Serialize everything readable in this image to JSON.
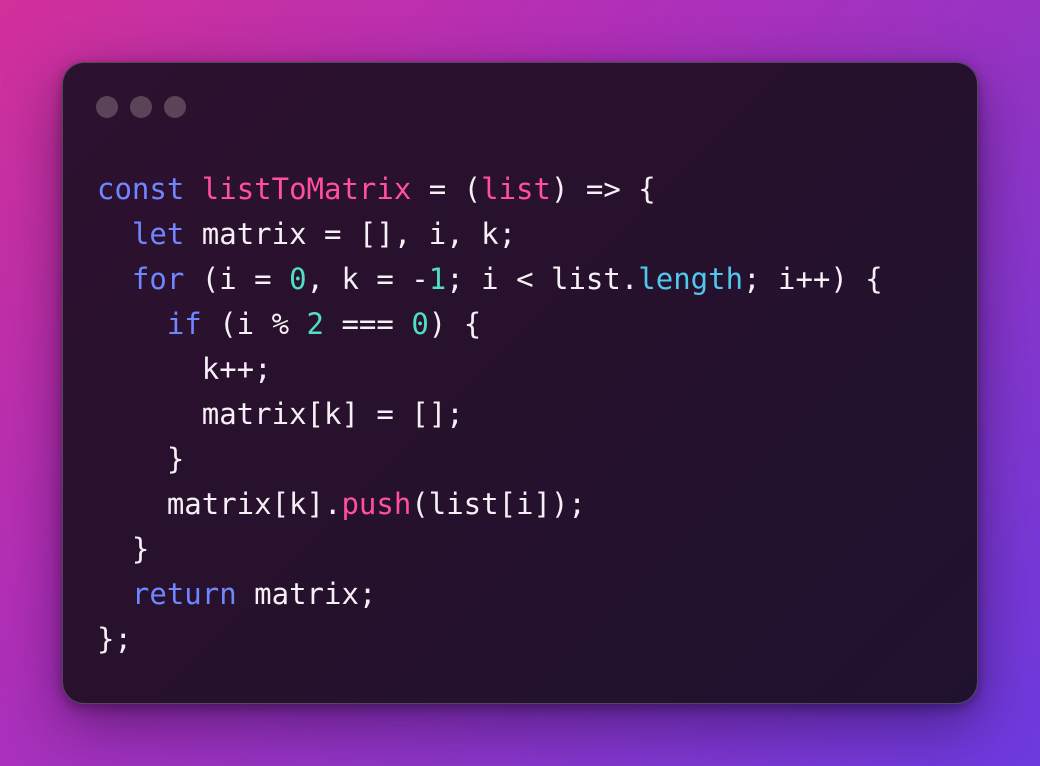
{
  "window": {
    "traffic_lights": [
      "dot",
      "dot",
      "dot"
    ]
  },
  "colors": {
    "keyword": "#6f86ff",
    "function": "#ff4f9e",
    "number": "#4fe0c2",
    "property": "#4fc7ee",
    "plain": "#f6f0f6"
  },
  "code": {
    "lines": [
      {
        "indent": 0,
        "tokens": [
          {
            "t": "const",
            "c": "kw"
          },
          {
            "t": " ",
            "c": "pl"
          },
          {
            "t": "listToMatrix",
            "c": "fn"
          },
          {
            "t": " = (",
            "c": "pl"
          },
          {
            "t": "list",
            "c": "fn"
          },
          {
            "t": ") => {",
            "c": "pl"
          }
        ]
      },
      {
        "indent": 1,
        "tokens": [
          {
            "t": "let",
            "c": "kw"
          },
          {
            "t": " matrix = [], i, k;",
            "c": "pl"
          }
        ]
      },
      {
        "indent": 1,
        "tokens": [
          {
            "t": "for",
            "c": "kw"
          },
          {
            "t": " (i = ",
            "c": "pl"
          },
          {
            "t": "0",
            "c": "num"
          },
          {
            "t": ", k = -",
            "c": "pl"
          },
          {
            "t": "1",
            "c": "num"
          },
          {
            "t": "; i < list.",
            "c": "pl"
          },
          {
            "t": "length",
            "c": "prop"
          },
          {
            "t": "; i++) {",
            "c": "pl"
          }
        ]
      },
      {
        "indent": 2,
        "tokens": [
          {
            "t": "if",
            "c": "kw"
          },
          {
            "t": " (i % ",
            "c": "pl"
          },
          {
            "t": "2",
            "c": "num"
          },
          {
            "t": " === ",
            "c": "pl"
          },
          {
            "t": "0",
            "c": "num"
          },
          {
            "t": ") {",
            "c": "pl"
          }
        ]
      },
      {
        "indent": 3,
        "tokens": [
          {
            "t": "k++;",
            "c": "pl"
          }
        ]
      },
      {
        "indent": 3,
        "tokens": [
          {
            "t": "matrix[k] = [];",
            "c": "pl"
          }
        ]
      },
      {
        "indent": 2,
        "tokens": [
          {
            "t": "}",
            "c": "pl"
          }
        ]
      },
      {
        "indent": 2,
        "tokens": [
          {
            "t": "matrix[k].",
            "c": "pl"
          },
          {
            "t": "push",
            "c": "fn"
          },
          {
            "t": "(list[i]);",
            "c": "pl"
          }
        ]
      },
      {
        "indent": 1,
        "tokens": [
          {
            "t": "}",
            "c": "pl"
          }
        ]
      },
      {
        "indent": 1,
        "tokens": [
          {
            "t": "return",
            "c": "kw"
          },
          {
            "t": " matrix;",
            "c": "pl"
          }
        ]
      },
      {
        "indent": 0,
        "tokens": [
          {
            "t": "};",
            "c": "pl"
          }
        ]
      }
    ]
  }
}
